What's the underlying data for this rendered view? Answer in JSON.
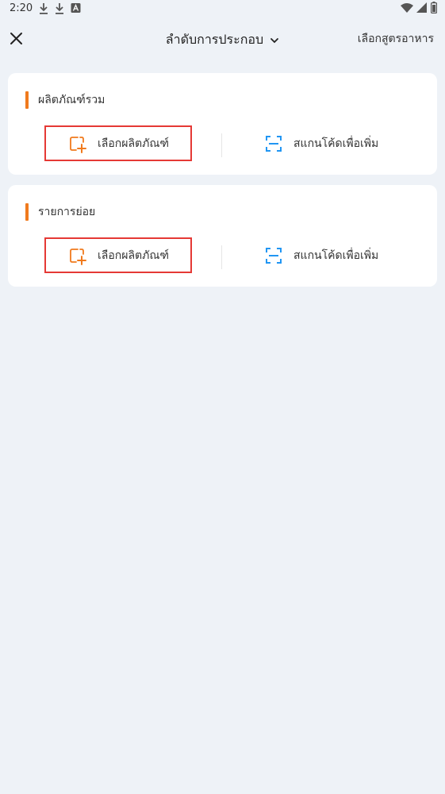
{
  "status_bar": {
    "time": "2:20",
    "icons": [
      "download-icon",
      "download-icon",
      "a-box-icon",
      "wifi-icon",
      "signal-icon",
      "battery-icon"
    ]
  },
  "header": {
    "title": "ลำดับการประกอบ",
    "right_action": "เลือกสูตรอาหาร",
    "close_icon": "close-icon",
    "dropdown_icon": "chevron-down-icon"
  },
  "sections": [
    {
      "title": "ผลิตภัณฑ์รวม",
      "select_label": "เลือกผลิตภัณฑ์",
      "scan_label": "สแกนโค้ดเพื่อเพิ่ม"
    },
    {
      "title": "รายการย่อย",
      "select_label": "เลือกผลิตภัณฑ์",
      "scan_label": "สแกนโค้ดเพื่อเพิ่ม"
    }
  ],
  "colors": {
    "accent": "#f07a1d",
    "scan_blue": "#2196f3",
    "highlight_red": "#e53935",
    "background": "#eef2f7"
  }
}
